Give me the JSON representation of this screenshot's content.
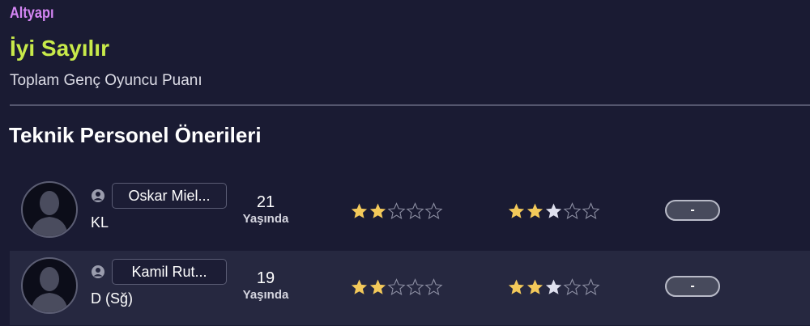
{
  "section_label": "Altyapı",
  "youth_rating": {
    "value": "İyi Sayılır",
    "description": "Toplam Genç Oyuncu Puanı"
  },
  "recommendations": {
    "heading": "Teknik Personel Önerileri",
    "players": [
      {
        "name": "Oskar Miel...",
        "position": "KL",
        "age": "21",
        "age_unit": "Yaşında",
        "ability_stars": 2,
        "potential_stars": 2.5,
        "max_stars": 5,
        "status": "-"
      },
      {
        "name": "Kamil Rut...",
        "position": "D (Sğ)",
        "age": "19",
        "age_unit": "Yaşında",
        "ability_stars": 2,
        "potential_stars": 2.5,
        "max_stars": 5,
        "status": "-"
      }
    ]
  },
  "colors": {
    "background": "#1a1b33",
    "row_alt": "#262840",
    "section_label": "#d586f4",
    "rating_value": "#c8ea4a",
    "star_gold": "#f3c95a",
    "star_silver": "#dfe0ee"
  },
  "icons": {
    "avatar": "silhouette-avatar-icon",
    "person": "person-icon",
    "star": "star-icon"
  }
}
